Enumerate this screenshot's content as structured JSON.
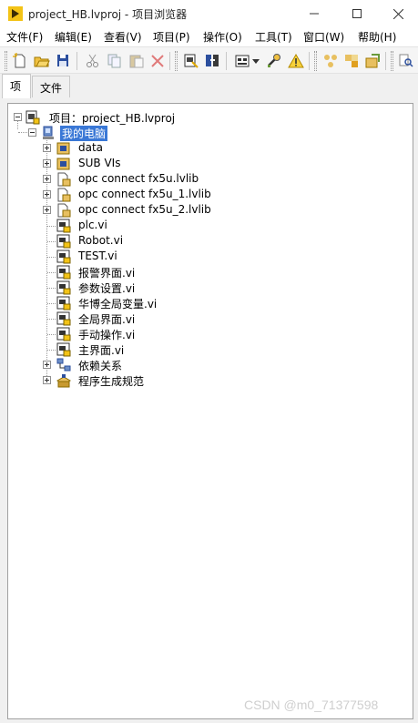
{
  "window": {
    "title": "project_HB.lvproj - 项目浏览器",
    "minimize_glyph": "—",
    "maximize_glyph": "☐",
    "close_glyph": "✕"
  },
  "menu": [
    {
      "label": "文件(F)"
    },
    {
      "label": "编辑(E)"
    },
    {
      "label": "查看(V)"
    },
    {
      "label": "项目(P)"
    },
    {
      "label": "操作(O)"
    },
    {
      "label": "工具(T)"
    },
    {
      "label": "窗口(W)"
    },
    {
      "label": "帮助(H)"
    }
  ],
  "toolbar": {
    "icons": [
      "new-icon",
      "open-icon",
      "save-all-icon",
      "cut-icon",
      "copy-icon",
      "paste-icon",
      "delete-icon",
      "build-icon",
      "deploy-icon",
      "view-icon",
      "dropdown-arrow-icon",
      "wrench-icon",
      "warning-icon",
      "vi-hierarchy-icon",
      "group-icon",
      "ungroup-icon",
      "find-icon"
    ]
  },
  "tabs": [
    {
      "label": "项"
    },
    {
      "label": "文件"
    }
  ],
  "tree": {
    "project": "项目：project_HB.lvproj",
    "computer": "我的电脑",
    "items": [
      {
        "label": "data",
        "icon": "folder-lib-icon"
      },
      {
        "label": "SUB VIs",
        "icon": "folder-lib-icon"
      },
      {
        "label": "opc connect fx5u.lvlib",
        "icon": "lvlib-icon"
      },
      {
        "label": "opc connect fx5u_1.lvlib",
        "icon": "lvlib-icon"
      },
      {
        "label": "opc connect fx5u_2.lvlib",
        "icon": "lvlib-icon"
      },
      {
        "label": "plc.vi",
        "icon": "vi-icon"
      },
      {
        "label": "Robot.vi",
        "icon": "vi-icon"
      },
      {
        "label": "TEST.vi",
        "icon": "vi-icon"
      },
      {
        "label": "报警界面.vi",
        "icon": "vi-icon"
      },
      {
        "label": "参数设置.vi",
        "icon": "vi-icon"
      },
      {
        "label": "华博全局变量.vi",
        "icon": "vi-icon"
      },
      {
        "label": "全局界面.vi",
        "icon": "vi-icon"
      },
      {
        "label": "手动操作.vi",
        "icon": "vi-icon"
      },
      {
        "label": "主界面.vi",
        "icon": "vi-icon"
      },
      {
        "label": "依赖关系",
        "icon": "dependencies-icon"
      },
      {
        "label": "程序生成规范",
        "icon": "build-spec-icon"
      }
    ]
  },
  "watermark": "CSDN @m0_71377598"
}
